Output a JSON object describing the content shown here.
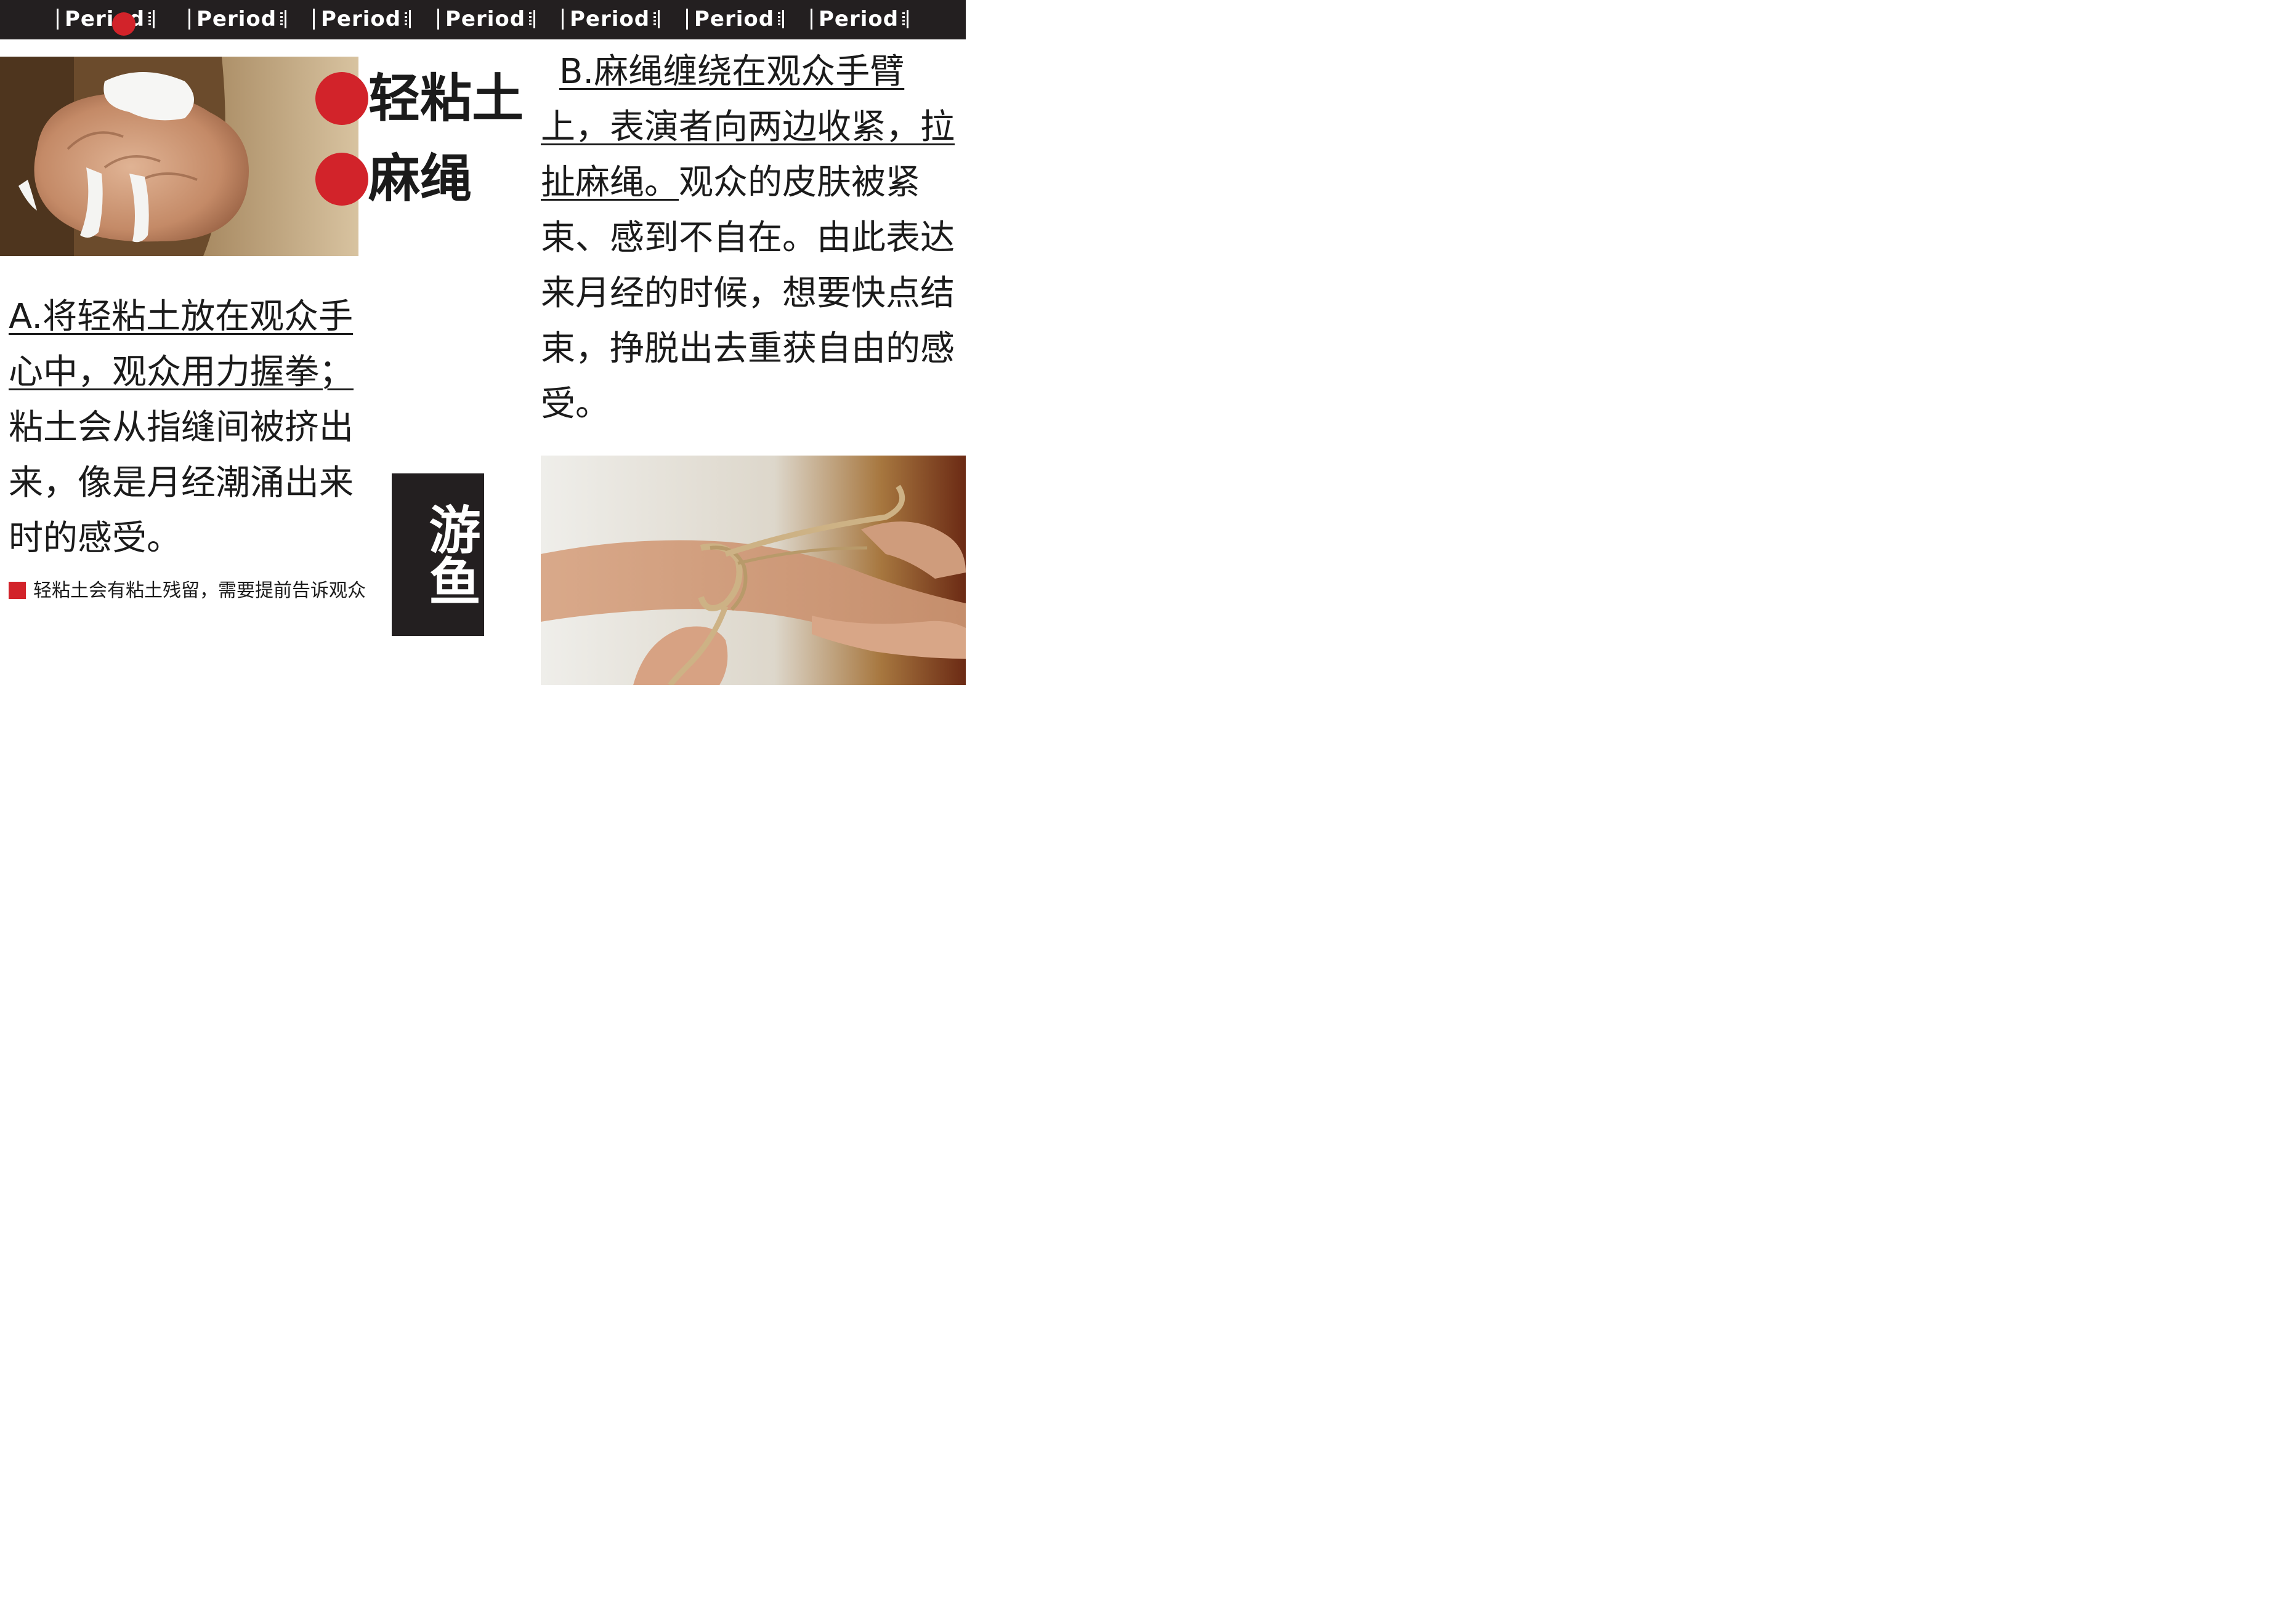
{
  "colors": {
    "accent": "#d2232a",
    "bar": "#231f20",
    "text": "#1b1b1b"
  },
  "topbar": {
    "tabs": [
      {
        "label": "Period"
      },
      {
        "label": "Period"
      },
      {
        "label": "Period"
      },
      {
        "label": "Period"
      },
      {
        "label": "Period"
      },
      {
        "label": "Period"
      },
      {
        "label": "Period"
      }
    ]
  },
  "headings": {
    "first": "轻粘土",
    "second": "麻绳"
  },
  "section_a": {
    "underlined": "A.将轻粘土放在观众手心中，观众用力握拳；",
    "plain": "粘土会从指缝间被挤出来，像是月经潮涌出来时的感受。"
  },
  "section_b": {
    "underlined": "B.麻绳缠绕在观众手臂上，表演者向两边收紧，拉扯麻绳。",
    "plain": "观众的皮肤被紧束、感到不自在。由此表达来月经的时候，想要快点结束，挣脱出去重获自由的感受。"
  },
  "note": {
    "text": "轻粘土会有粘土残留，需要提前告诉观众"
  },
  "label_box": {
    "text": "游鱼"
  },
  "images": {
    "clay": "hand-squeezing-clay-photo",
    "rope": "rope-wrapped-wrist-photo"
  }
}
